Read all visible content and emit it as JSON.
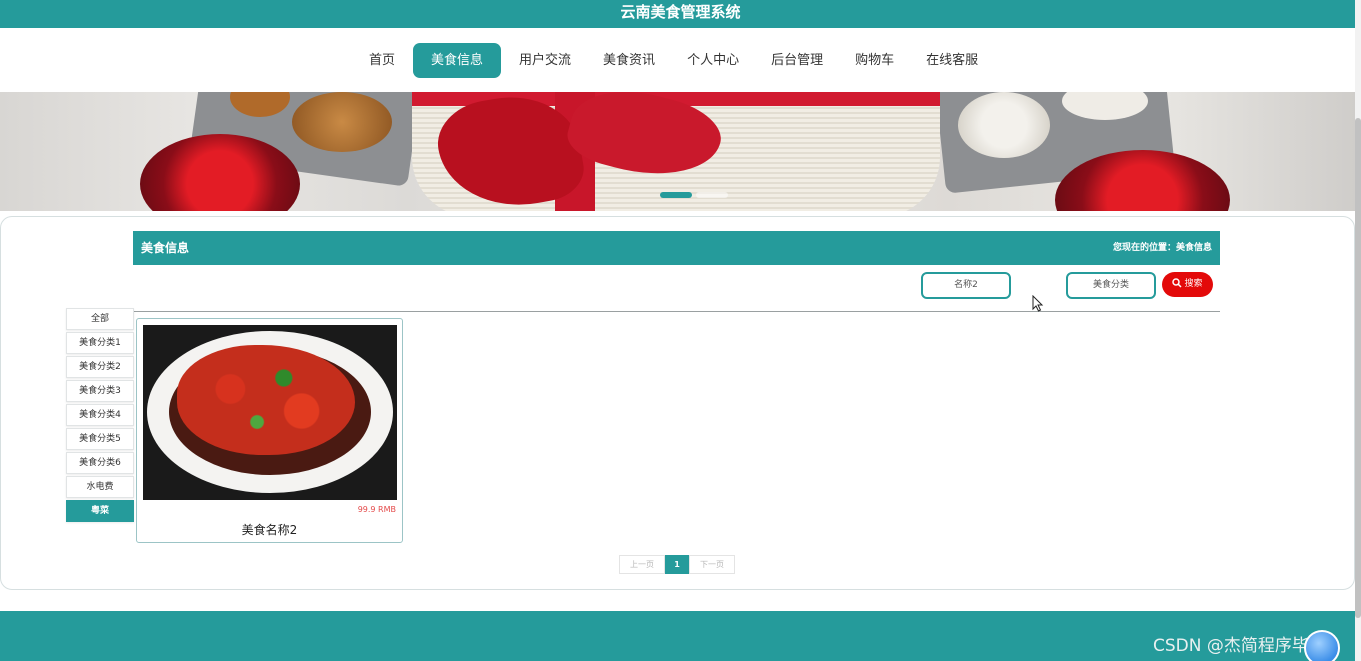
{
  "colors": {
    "brand": "#259b9b",
    "search_button": "#e30a0a",
    "price": "#e44a4a"
  },
  "app": {
    "title": "云南美食管理系统"
  },
  "nav": {
    "items": [
      {
        "label": "首页"
      },
      {
        "label": "美食信息",
        "active": true
      },
      {
        "label": "用户交流"
      },
      {
        "label": "美食资讯"
      },
      {
        "label": "个人中心"
      },
      {
        "label": "后台管理"
      },
      {
        "label": "购物车"
      },
      {
        "label": "在线客服"
      }
    ]
  },
  "banner": {
    "slide_count": 2,
    "active_slide": 1
  },
  "section": {
    "title": "美食信息",
    "breadcrumb": "您现在的位置：美食信息"
  },
  "search": {
    "name_value": "名称2",
    "category_placeholder": "美食分类",
    "button_label": "搜索",
    "button_icon": "search-icon"
  },
  "categories": [
    {
      "label": "全部"
    },
    {
      "label": "美食分类1"
    },
    {
      "label": "美食分类2"
    },
    {
      "label": "美食分类3"
    },
    {
      "label": "美食分类4"
    },
    {
      "label": "美食分类5"
    },
    {
      "label": "美食分类6"
    },
    {
      "label": "水电费"
    },
    {
      "label": "粤菜",
      "active": true
    }
  ],
  "products": [
    {
      "name": "美食名称2",
      "price": "99.9 RMB"
    }
  ],
  "pager": {
    "prev": "上一页",
    "current": "1",
    "next": "下一页"
  },
  "watermark": "CSDN @杰简程序毕设"
}
